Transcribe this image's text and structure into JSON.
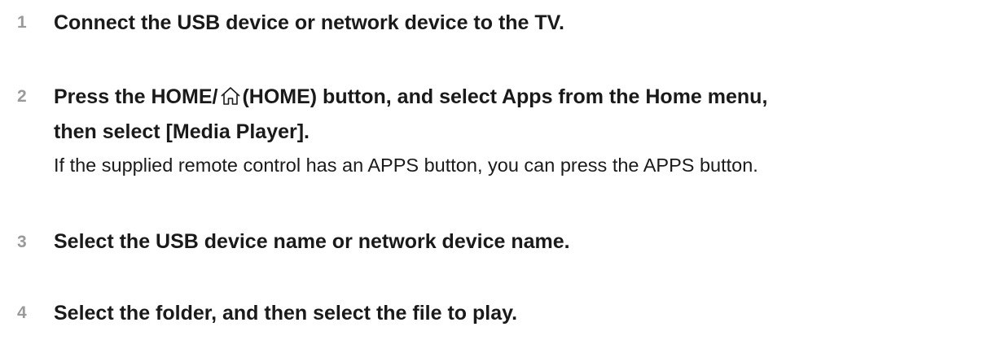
{
  "steps": [
    {
      "number": "1",
      "title": "Connect the USB device or network device to the TV."
    },
    {
      "number": "2",
      "title_part1": "Press the HOME/",
      "title_part2": "(HOME) button, and select Apps from the Home menu,",
      "title_line2": "then select [Media Player].",
      "note": "If the supplied remote control has an APPS button, you can press the APPS button.",
      "icon": "home-icon"
    },
    {
      "number": "3",
      "title": "Select the USB device name or network device name."
    },
    {
      "number": "4",
      "title": "Select the folder, and then select the file to play."
    }
  ]
}
